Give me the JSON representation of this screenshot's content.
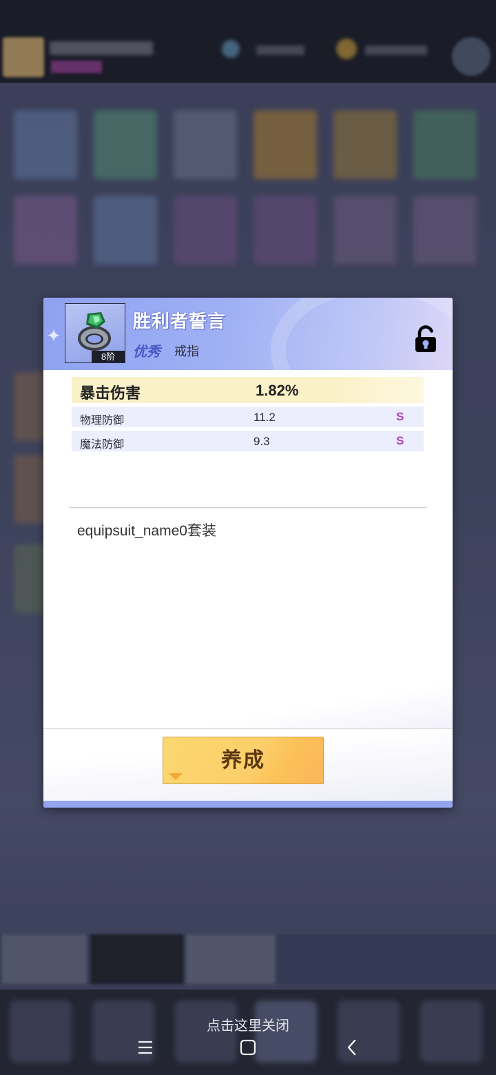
{
  "dialog": {
    "item": {
      "name": "胜利者誓言",
      "quality": "优秀",
      "type": "戒指",
      "tier": "8阶"
    },
    "main_stat": {
      "label": "暴击伤害",
      "value": "1.82%"
    },
    "sub_stats": [
      {
        "label": "物理防御",
        "value": "11.2",
        "grade": "S"
      },
      {
        "label": "魔法防御",
        "value": "9.3",
        "grade": "S"
      }
    ],
    "suit_name": "equipsuit_name0套装",
    "cultivate_button": "养成",
    "lock_state": "unlocked"
  },
  "close_hint": "点击这里关闭",
  "colors": {
    "header_blue": "#8fa2f2",
    "button_yellow": "#fcd770",
    "grade_purple": "#b040b8",
    "main_stat_bg": "#fbf1c8",
    "sub_stat_bg": "#eceefd"
  },
  "icons": {
    "item": "ring-icon",
    "lock": "unlock-icon",
    "nav_menu": "menu-icon",
    "nav_home": "home-square-icon",
    "nav_back": "back-chevron-icon"
  }
}
